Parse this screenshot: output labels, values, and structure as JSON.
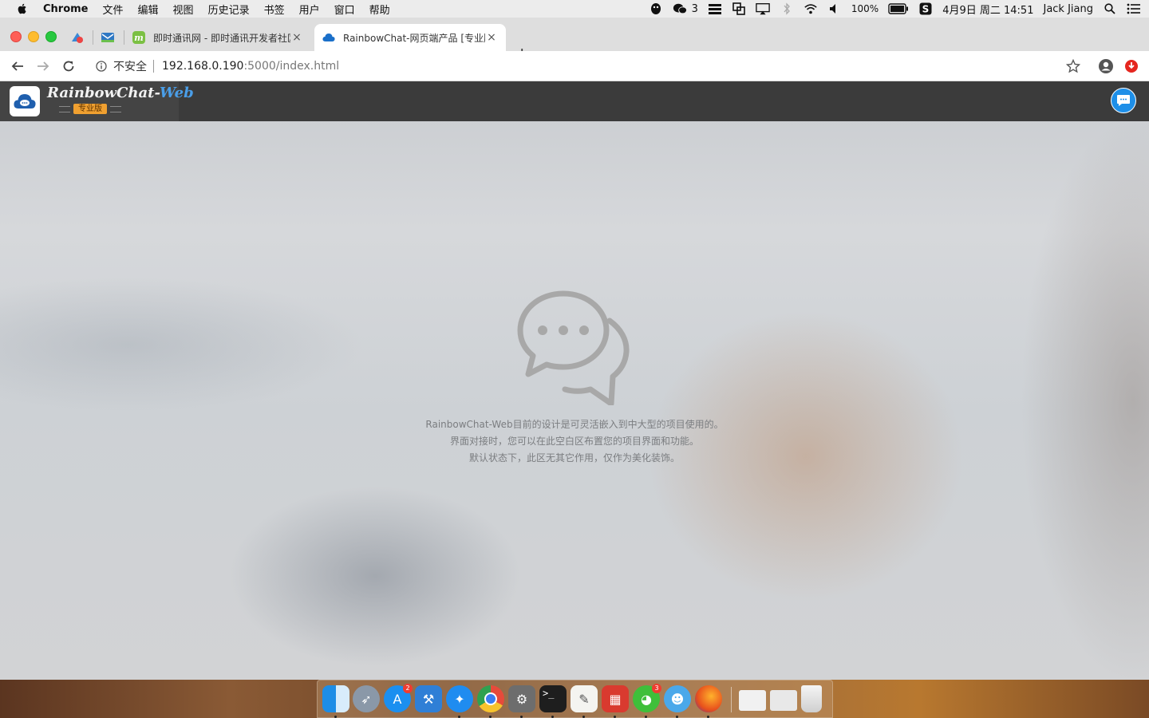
{
  "menubar": {
    "app_name": "Chrome",
    "menus": [
      "文件",
      "编辑",
      "视图",
      "历史记录",
      "书签",
      "用户",
      "窗口",
      "帮助"
    ],
    "wechat_count": "3",
    "battery": "100%",
    "datetime": "4月9日 周二  14:51",
    "user": "Jack Jiang"
  },
  "browser": {
    "tabs": [
      {
        "title": "即时通讯网 - 即时通讯开发者社区",
        "active": false
      },
      {
        "title": "RainbowChat-网页端产品 [专业版]",
        "active": true
      }
    ],
    "close_glyph": "×",
    "new_tab_glyph": "+",
    "security_label": "不安全",
    "url_host": "192.168.0.190",
    "url_path": ":5000/index.html"
  },
  "app": {
    "logo_main": "RainbowChat-",
    "logo_accent": "Web",
    "edition": "专业版",
    "placeholder_lines": [
      "RainbowChat-Web目前的设计是可灵活嵌入到中大型的项目使用的。",
      "界面对接时，您可以在此空白区布置您的项目界面和功能。",
      "默认状态下，此区无其它作用，仅作为美化装饰。"
    ]
  },
  "dock": {
    "apps": [
      "finder-icon",
      "launchpad-icon",
      "app-store-icon",
      "xcode-icon",
      "safari-icon",
      "chrome-icon",
      "system-preferences-icon",
      "terminal-icon",
      "textedit-icon",
      "parallels-icon",
      "wechat-icon",
      "qq-icon",
      "firefox-icon",
      "downloads-stack-icon",
      "documents-stack-icon",
      "trash-icon"
    ],
    "app_store_badge": "2",
    "wechat_badge": "3"
  }
}
